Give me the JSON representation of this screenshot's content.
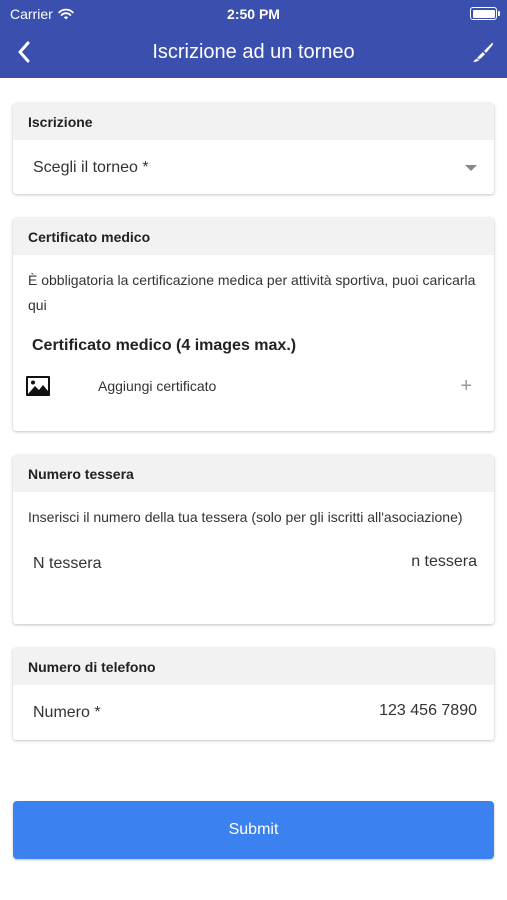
{
  "status_bar": {
    "carrier": "Carrier",
    "time": "2:50 PM"
  },
  "navbar": {
    "title": "Iscrizione ad un torneo",
    "back_icon": "chevron-left-icon",
    "action_icon": "paintbrush-icon"
  },
  "sections": {
    "iscrizione": {
      "header": "Iscrizione",
      "select_value": "Scegli il torneo *"
    },
    "certificato": {
      "header": "Certificato medico",
      "description": "È obbligatoria la certificazione medica per attività sportiva, puoi caricarla qui",
      "title": "Certificato medico (4 images max.)",
      "add_label": "Aggiungi certificato",
      "add_symbol": "+"
    },
    "tessera": {
      "header": "Numero tessera",
      "description": "Inserisci il numero della tua tessera (solo per gli iscritti all'asociazione)",
      "label": "N tessera",
      "placeholder": "n tessera"
    },
    "telefono": {
      "header": "Numero di telefono",
      "label": "Numero *",
      "placeholder": "123 456 7890"
    }
  },
  "submit_label": "Submit",
  "colors": {
    "navbar": "#3a4fae",
    "submit": "#3b82f0",
    "card_header": "#f2f2f2"
  }
}
